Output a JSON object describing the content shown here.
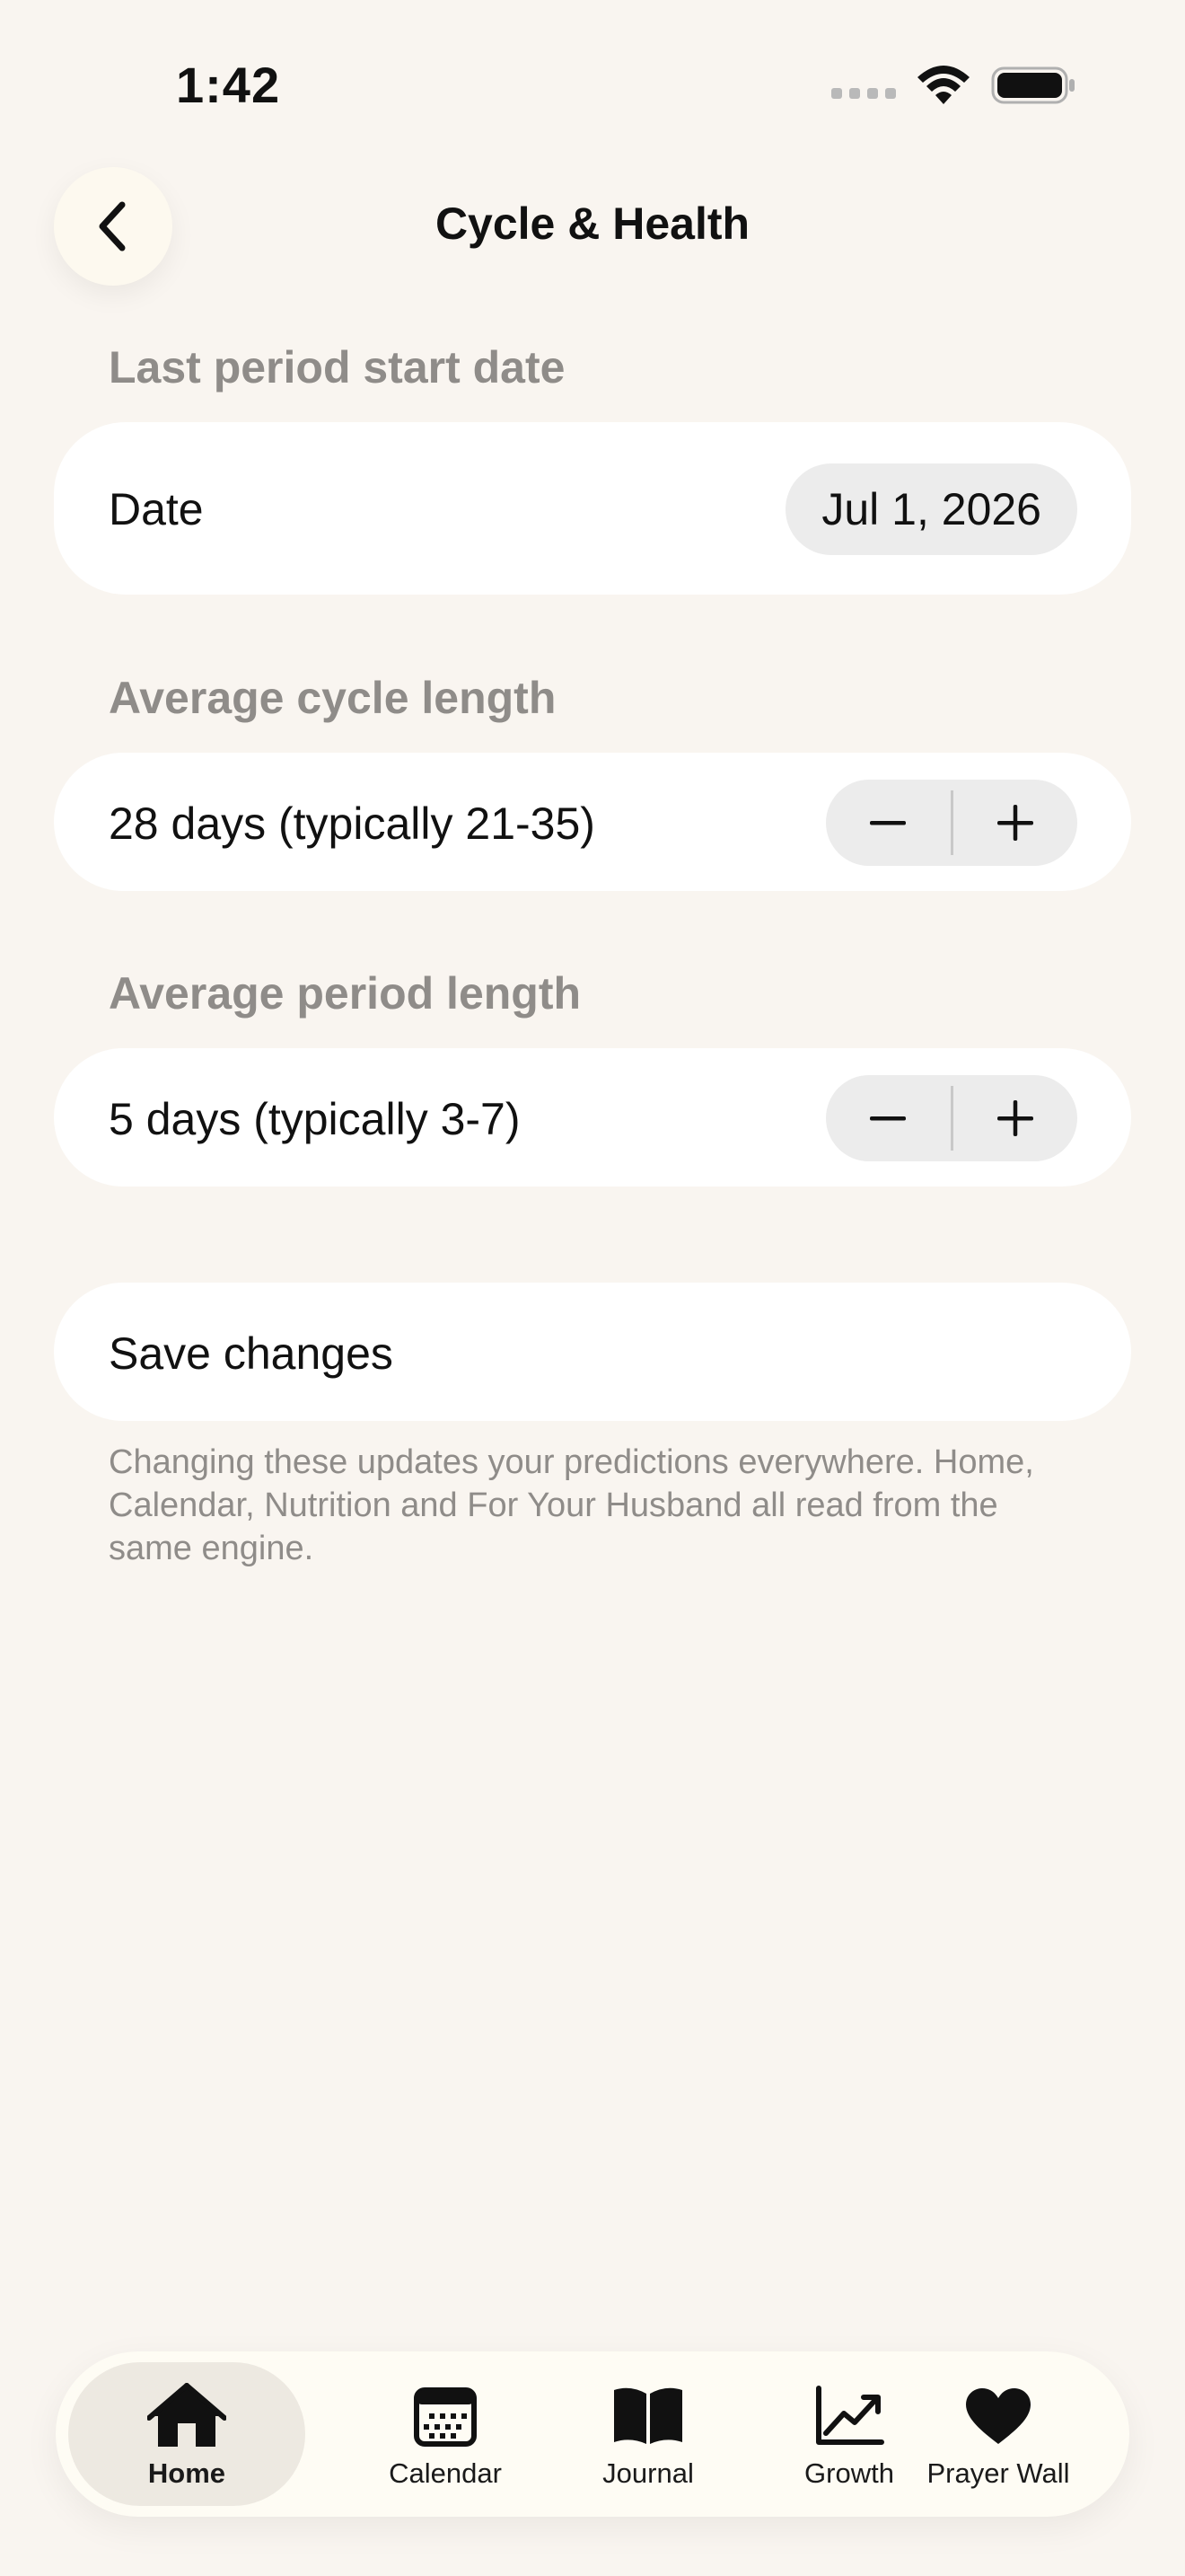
{
  "status_bar": {
    "time": "1:42"
  },
  "header": {
    "title": "Cycle & Health"
  },
  "last_period": {
    "section_label": "Last period start date",
    "field_label": "Date",
    "value": "Jul 1, 2026"
  },
  "cycle_length": {
    "section_label": "Average cycle length",
    "value_text": "28 days (typically 21-35)"
  },
  "period_length": {
    "section_label": "Average period length",
    "value_text": "5 days (typically 3-7)"
  },
  "save": {
    "label": "Save changes"
  },
  "helper_text": "Changing these updates your predictions everywhere. Home, Calendar, Nutrition and For Your Husband all read from the same engine.",
  "tabs": [
    {
      "label": "Home",
      "icon": "home-icon",
      "active": true
    },
    {
      "label": "Calendar",
      "icon": "calendar-icon",
      "active": false
    },
    {
      "label": "Journal",
      "icon": "book-icon",
      "active": false
    },
    {
      "label": "Growth",
      "icon": "chart-line-icon",
      "active": false
    },
    {
      "label": "Prayer Wall",
      "icon": "heart-icon",
      "active": false
    }
  ],
  "colors": {
    "background": "#f9f5f0",
    "card": "#ffffff",
    "muted_text": "#8f8c89",
    "pill": "#ececec"
  }
}
